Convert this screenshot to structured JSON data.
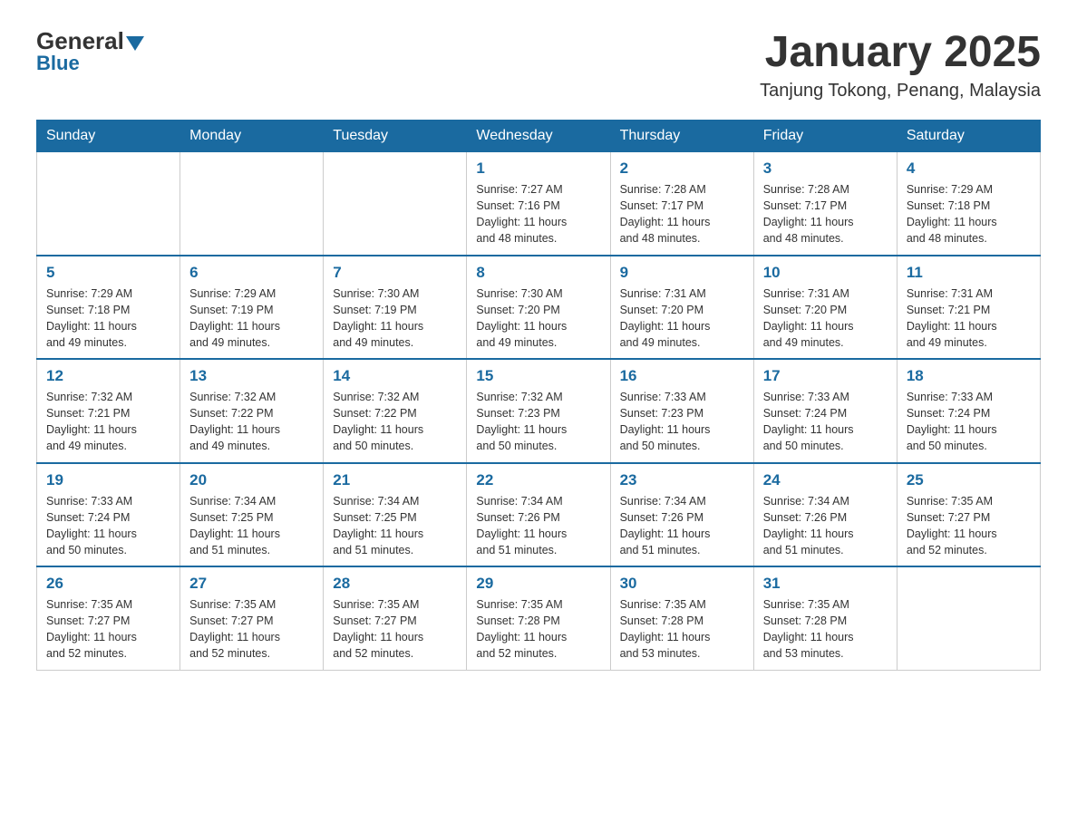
{
  "header": {
    "logo_general": "General",
    "logo_blue": "Blue",
    "title": "January 2025",
    "location": "Tanjung Tokong, Penang, Malaysia"
  },
  "weekdays": [
    "Sunday",
    "Monday",
    "Tuesday",
    "Wednesday",
    "Thursday",
    "Friday",
    "Saturday"
  ],
  "weeks": [
    [
      {
        "day": "",
        "info": ""
      },
      {
        "day": "",
        "info": ""
      },
      {
        "day": "",
        "info": ""
      },
      {
        "day": "1",
        "info": "Sunrise: 7:27 AM\nSunset: 7:16 PM\nDaylight: 11 hours\nand 48 minutes."
      },
      {
        "day": "2",
        "info": "Sunrise: 7:28 AM\nSunset: 7:17 PM\nDaylight: 11 hours\nand 48 minutes."
      },
      {
        "day": "3",
        "info": "Sunrise: 7:28 AM\nSunset: 7:17 PM\nDaylight: 11 hours\nand 48 minutes."
      },
      {
        "day": "4",
        "info": "Sunrise: 7:29 AM\nSunset: 7:18 PM\nDaylight: 11 hours\nand 48 minutes."
      }
    ],
    [
      {
        "day": "5",
        "info": "Sunrise: 7:29 AM\nSunset: 7:18 PM\nDaylight: 11 hours\nand 49 minutes."
      },
      {
        "day": "6",
        "info": "Sunrise: 7:29 AM\nSunset: 7:19 PM\nDaylight: 11 hours\nand 49 minutes."
      },
      {
        "day": "7",
        "info": "Sunrise: 7:30 AM\nSunset: 7:19 PM\nDaylight: 11 hours\nand 49 minutes."
      },
      {
        "day": "8",
        "info": "Sunrise: 7:30 AM\nSunset: 7:20 PM\nDaylight: 11 hours\nand 49 minutes."
      },
      {
        "day": "9",
        "info": "Sunrise: 7:31 AM\nSunset: 7:20 PM\nDaylight: 11 hours\nand 49 minutes."
      },
      {
        "day": "10",
        "info": "Sunrise: 7:31 AM\nSunset: 7:20 PM\nDaylight: 11 hours\nand 49 minutes."
      },
      {
        "day": "11",
        "info": "Sunrise: 7:31 AM\nSunset: 7:21 PM\nDaylight: 11 hours\nand 49 minutes."
      }
    ],
    [
      {
        "day": "12",
        "info": "Sunrise: 7:32 AM\nSunset: 7:21 PM\nDaylight: 11 hours\nand 49 minutes."
      },
      {
        "day": "13",
        "info": "Sunrise: 7:32 AM\nSunset: 7:22 PM\nDaylight: 11 hours\nand 49 minutes."
      },
      {
        "day": "14",
        "info": "Sunrise: 7:32 AM\nSunset: 7:22 PM\nDaylight: 11 hours\nand 50 minutes."
      },
      {
        "day": "15",
        "info": "Sunrise: 7:32 AM\nSunset: 7:23 PM\nDaylight: 11 hours\nand 50 minutes."
      },
      {
        "day": "16",
        "info": "Sunrise: 7:33 AM\nSunset: 7:23 PM\nDaylight: 11 hours\nand 50 minutes."
      },
      {
        "day": "17",
        "info": "Sunrise: 7:33 AM\nSunset: 7:24 PM\nDaylight: 11 hours\nand 50 minutes."
      },
      {
        "day": "18",
        "info": "Sunrise: 7:33 AM\nSunset: 7:24 PM\nDaylight: 11 hours\nand 50 minutes."
      }
    ],
    [
      {
        "day": "19",
        "info": "Sunrise: 7:33 AM\nSunset: 7:24 PM\nDaylight: 11 hours\nand 50 minutes."
      },
      {
        "day": "20",
        "info": "Sunrise: 7:34 AM\nSunset: 7:25 PM\nDaylight: 11 hours\nand 51 minutes."
      },
      {
        "day": "21",
        "info": "Sunrise: 7:34 AM\nSunset: 7:25 PM\nDaylight: 11 hours\nand 51 minutes."
      },
      {
        "day": "22",
        "info": "Sunrise: 7:34 AM\nSunset: 7:26 PM\nDaylight: 11 hours\nand 51 minutes."
      },
      {
        "day": "23",
        "info": "Sunrise: 7:34 AM\nSunset: 7:26 PM\nDaylight: 11 hours\nand 51 minutes."
      },
      {
        "day": "24",
        "info": "Sunrise: 7:34 AM\nSunset: 7:26 PM\nDaylight: 11 hours\nand 51 minutes."
      },
      {
        "day": "25",
        "info": "Sunrise: 7:35 AM\nSunset: 7:27 PM\nDaylight: 11 hours\nand 52 minutes."
      }
    ],
    [
      {
        "day": "26",
        "info": "Sunrise: 7:35 AM\nSunset: 7:27 PM\nDaylight: 11 hours\nand 52 minutes."
      },
      {
        "day": "27",
        "info": "Sunrise: 7:35 AM\nSunset: 7:27 PM\nDaylight: 11 hours\nand 52 minutes."
      },
      {
        "day": "28",
        "info": "Sunrise: 7:35 AM\nSunset: 7:27 PM\nDaylight: 11 hours\nand 52 minutes."
      },
      {
        "day": "29",
        "info": "Sunrise: 7:35 AM\nSunset: 7:28 PM\nDaylight: 11 hours\nand 52 minutes."
      },
      {
        "day": "30",
        "info": "Sunrise: 7:35 AM\nSunset: 7:28 PM\nDaylight: 11 hours\nand 53 minutes."
      },
      {
        "day": "31",
        "info": "Sunrise: 7:35 AM\nSunset: 7:28 PM\nDaylight: 11 hours\nand 53 minutes."
      },
      {
        "day": "",
        "info": ""
      }
    ]
  ]
}
